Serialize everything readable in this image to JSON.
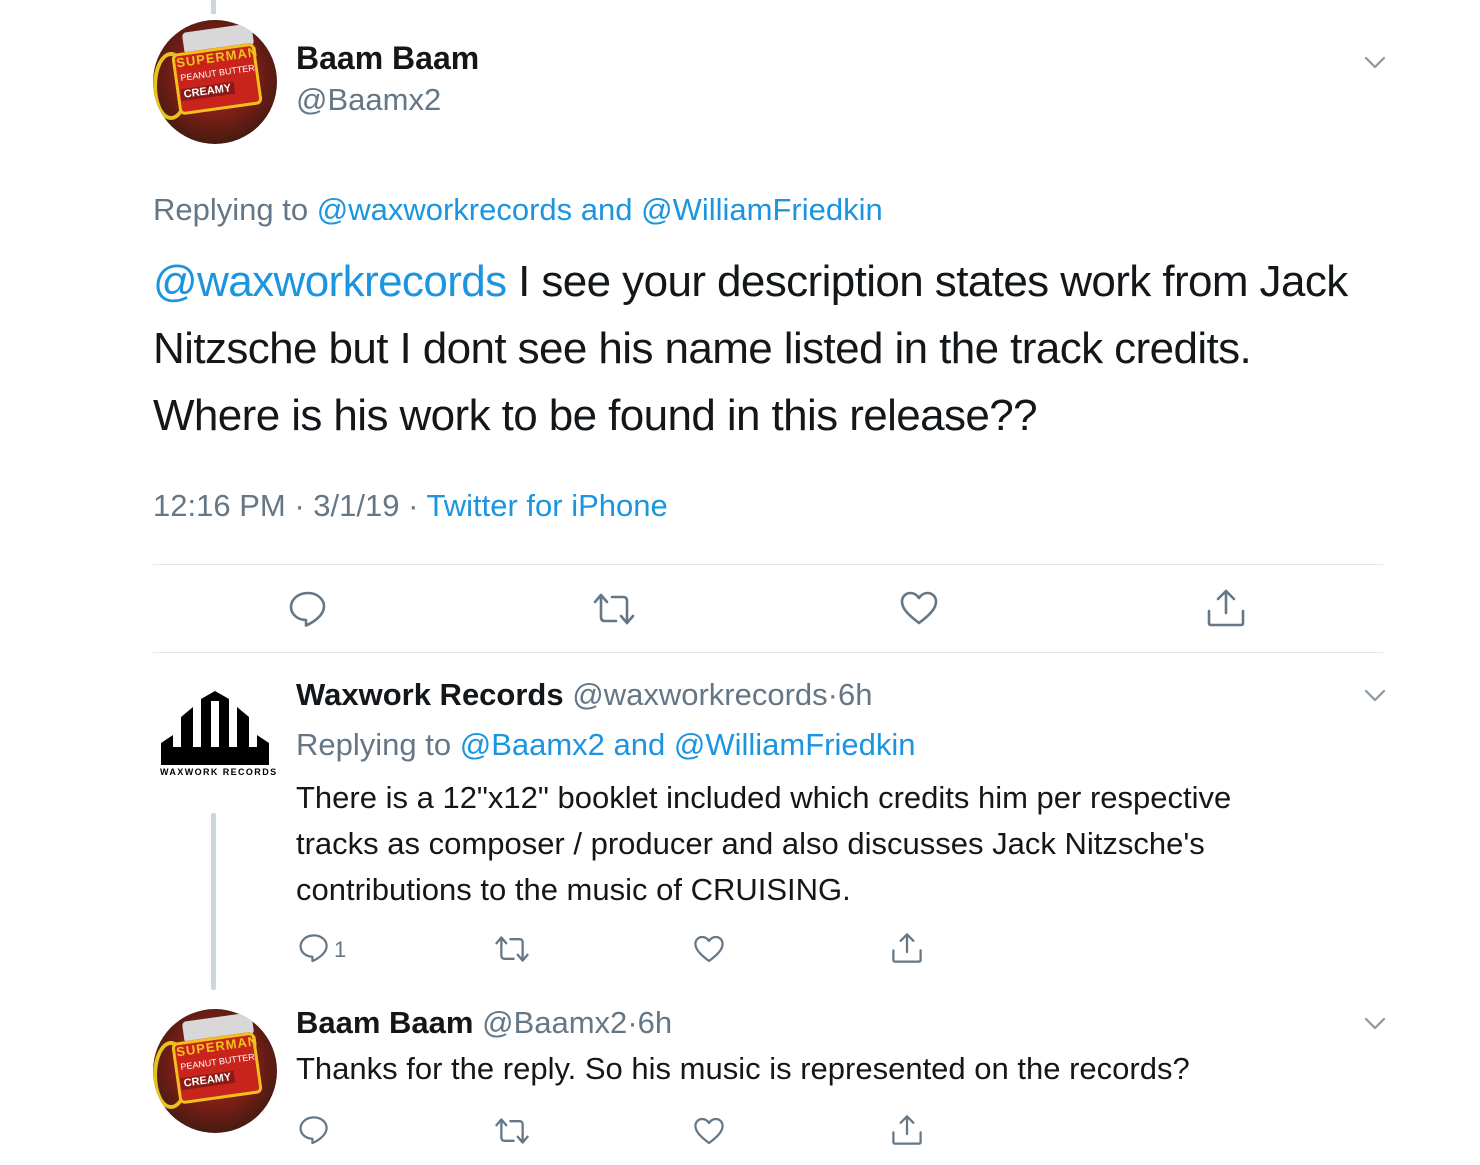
{
  "main_tweet": {
    "author_name": "Baam Baam",
    "author_handle": "@Baamx2",
    "avatar_text": {
      "brand": "SUPERMAN",
      "product": "PEANUT BUTTER",
      "variant": "CREAMY"
    },
    "replying_prefix": "Replying to",
    "replying_user1": "@waxworkrecords",
    "replying_and": "and",
    "replying_user2": "@WilliamFriedkin",
    "text_mention": "@waxworkrecords",
    "text_line1": " I see your description states work from Jack",
    "text_line2": "Nitzsche but I dont see his name listed in the track credits.",
    "text_line3": "Where is his work to be found in this release??",
    "time": "12:16 PM",
    "sep": "·",
    "date": "3/1/19",
    "source": "Twitter for iPhone"
  },
  "reply1": {
    "author_name": "Waxwork Records",
    "author_handle": "@waxworkrecords",
    "age_sep": "·",
    "age": "6h",
    "avatar_caption": "WAXWORK RECORDS",
    "replying_prefix": "Replying to",
    "replying_user1": "@Baamx2",
    "replying_and": "and",
    "replying_user2": "@WilliamFriedkin",
    "text_line1": "There is a 12\"x12\" booklet included which credits him per respective",
    "text_line2": "tracks as composer / producer and also discusses Jack Nitzsche's",
    "text_line3": "contributions to the music of CRUISING.",
    "reply_count": "1"
  },
  "reply2": {
    "author_name": "Baam Baam",
    "author_handle": "@Baamx2",
    "age_sep": "·",
    "age": "6h",
    "text": "Thanks for the reply. So his music is represented on the records?"
  },
  "colors": {
    "link": "#1b95e0",
    "muted": "#657786",
    "icon": "#657786",
    "divider": "#e1e8ed",
    "thread_line": "#ccd6dd"
  },
  "icons": [
    "reply-icon",
    "retweet-icon",
    "like-icon",
    "share-icon",
    "chevron-down-icon"
  ]
}
